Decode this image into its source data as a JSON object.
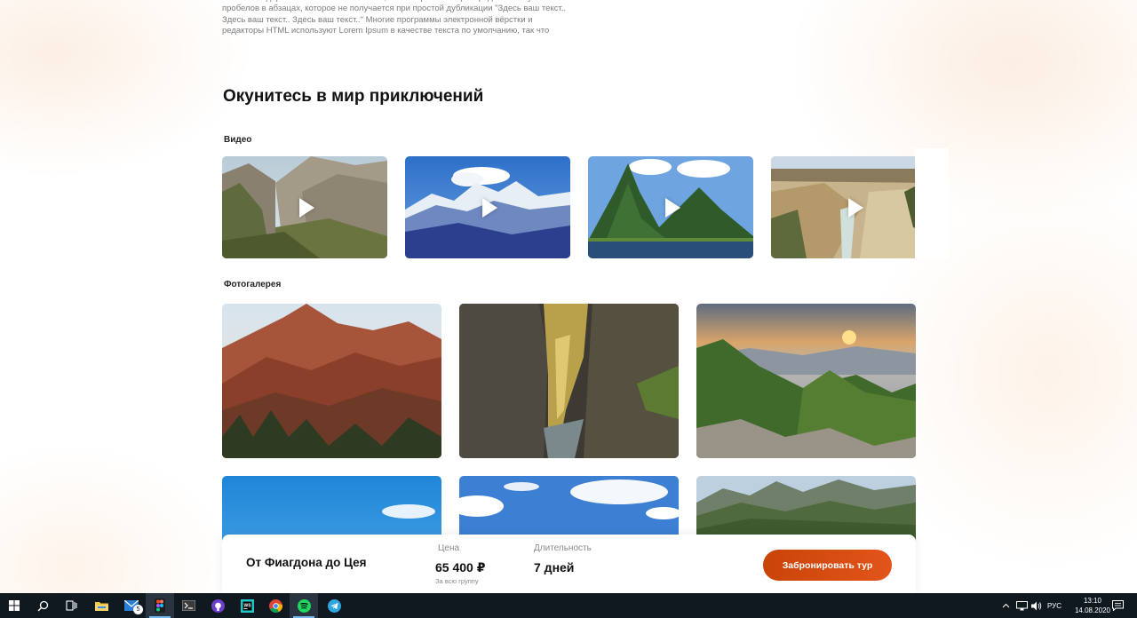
{
  "intro": {
    "paragraph": "менее стандартное заполнение шаблона, а также реальное распределение букв и пробелов в абзацах, которое не получается при простой дубликации \"Здесь ваш текст.. Здесь ваш текст.. Здесь ваш текст..\" Многие программы электронной вёрстки и редакторы HTML используют Lorem Ipsum в качестве текста по умолчанию, так что"
  },
  "adventure": {
    "title": "Окунитесь в мир приключений",
    "video_label": "Видео",
    "gallery_label": "Фотогалерея",
    "videos": [
      {
        "name": "canyon-video",
        "icon": "play-icon"
      },
      {
        "name": "snow-peaks-video",
        "icon": "play-icon"
      },
      {
        "name": "pitons-video",
        "icon": "play-icon"
      },
      {
        "name": "yellowstone-video",
        "icon": "play-icon"
      }
    ],
    "photos": [
      {
        "name": "red-mountain-photo"
      },
      {
        "name": "gorge-photo"
      },
      {
        "name": "sunset-valley-photo"
      },
      {
        "name": "blue-sky-photo"
      },
      {
        "name": "clouds-photo"
      },
      {
        "name": "mountain-range-photo"
      }
    ]
  },
  "booking": {
    "tour_name": "От Фиагдона до Цея",
    "price_label": "Цена",
    "price_value": "65 400 ₽",
    "price_note": "За всю группу",
    "duration_label": "Длительность",
    "duration_value": "7 дней",
    "book_button": "Забронировать тур",
    "accent_color": "#d44b10"
  },
  "taskbar": {
    "apps": [
      "windows-start-icon",
      "search-icon",
      "task-view-icon",
      "file-explorer-icon",
      "mail-icon",
      "figma-icon",
      "terminal-icon",
      "github-icon",
      "webstorm-icon",
      "chrome-icon",
      "spotify-icon",
      "telegram-icon"
    ],
    "mail_badge": "5",
    "language": "РУС",
    "time": "13:10",
    "date": "14.08.2020"
  }
}
